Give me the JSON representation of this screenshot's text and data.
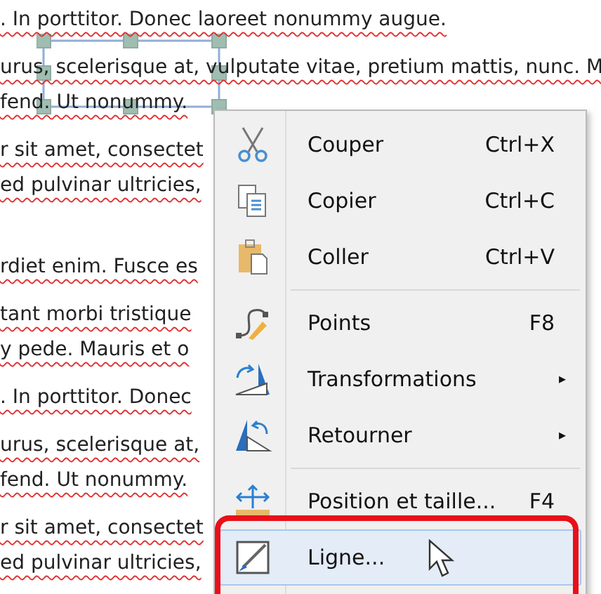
{
  "document": {
    "paragraphs": [
      {
        "lines": [
          ". In porttitor. Donec laoreet nonummy augue."
        ]
      },
      {
        "lines": [
          "urus, scelerisque at, vulputate vitae, pretium mattis, nunc. M",
          "fend. Ut nonummy."
        ]
      },
      {
        "lines": [
          "r sit amet, consectet",
          "ed pulvinar ultricies,"
        ]
      },
      {
        "lines": [
          "rdiet enim. Fusce es"
        ]
      },
      {
        "lines": [
          "tant morbi tristique",
          "y pede. Mauris et o"
        ]
      },
      {
        "lines": [
          ". In porttitor. Donec"
        ]
      },
      {
        "lines": [
          "urus, scelerisque at,",
          "fend. Ut nonummy."
        ]
      },
      {
        "lines": [
          "r sit amet, consectet",
          "ed pulvinar ultricies,"
        ]
      }
    ]
  },
  "context_menu": {
    "items": [
      {
        "kind": "item",
        "label": "Couper",
        "shortcut": "Ctrl+X",
        "selected": false
      },
      {
        "kind": "item",
        "label": "Copier",
        "shortcut": "Ctrl+C",
        "selected": false
      },
      {
        "kind": "item",
        "label": "Coller",
        "shortcut": "Ctrl+V",
        "selected": false
      },
      {
        "kind": "separator"
      },
      {
        "kind": "item",
        "label": "Points",
        "shortcut": "F8",
        "selected": false
      },
      {
        "kind": "submenu",
        "label": "Transformations",
        "arrow": "▸",
        "selected": false
      },
      {
        "kind": "submenu",
        "label": "Retourner",
        "arrow": "▸",
        "selected": false
      },
      {
        "kind": "separator"
      },
      {
        "kind": "item",
        "label": "Position et taille...",
        "shortcut": "F4",
        "selected": false
      },
      {
        "kind": "item",
        "label": "Ligne...",
        "selected": true
      }
    ]
  }
}
